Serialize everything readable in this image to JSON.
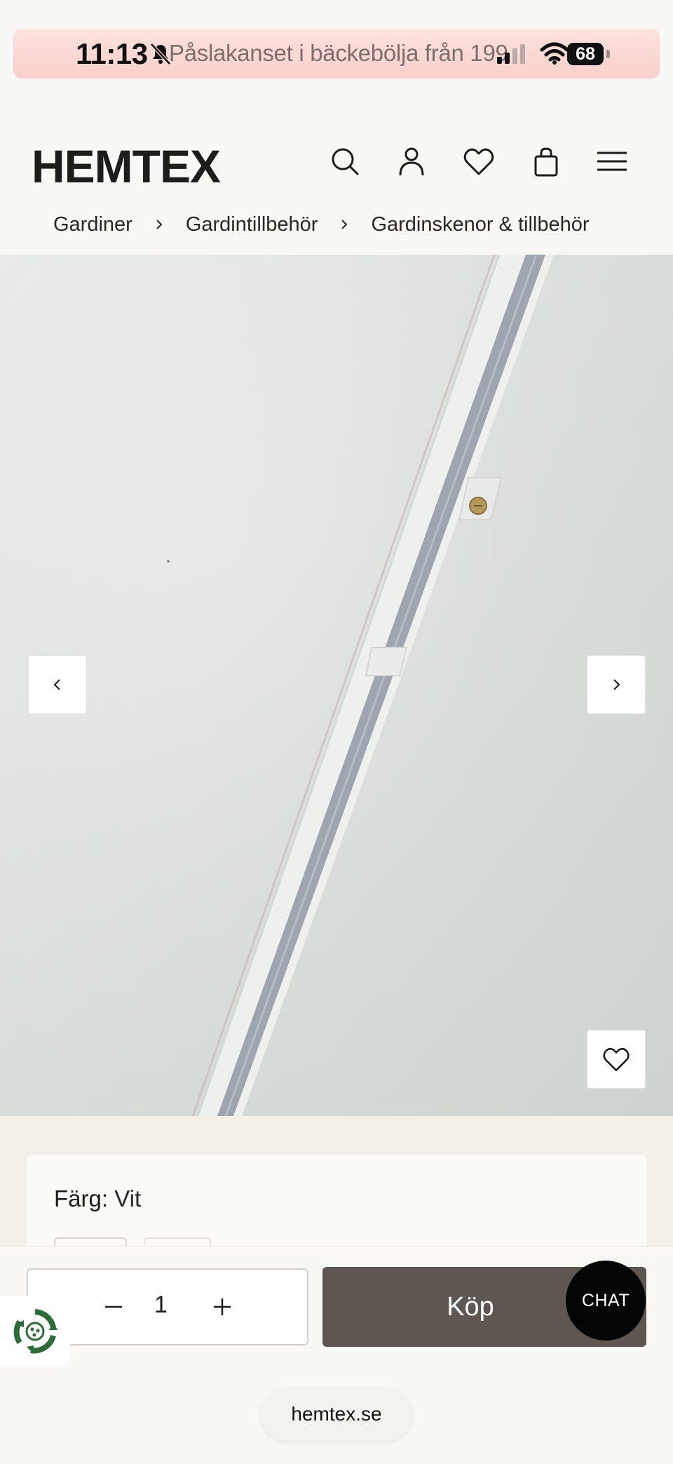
{
  "status_bar": {
    "time": "11:13",
    "notification_text": "Påslakanset i bäckebölja från 199",
    "battery": "68"
  },
  "header": {
    "logo": "HEMTEX",
    "icons": [
      "search-icon",
      "account-icon",
      "wishlist-heart-icon",
      "cart-bag-icon",
      "menu-icon"
    ]
  },
  "breadcrumb": [
    "Gardiner",
    "Gardintillbehör",
    "Gardinskenor & tillbehör"
  ],
  "product": {
    "color_label": "Färg:",
    "color_value": "Vit"
  },
  "purchase": {
    "quantity": "1",
    "buy_label": "Köp",
    "chat_label": "CHAT"
  },
  "browser": {
    "url": "hemtex.se"
  },
  "colors": {
    "buy_button": "#5e5650",
    "status_banner": "#f9cfca",
    "page_bg": "#faf8f4"
  }
}
